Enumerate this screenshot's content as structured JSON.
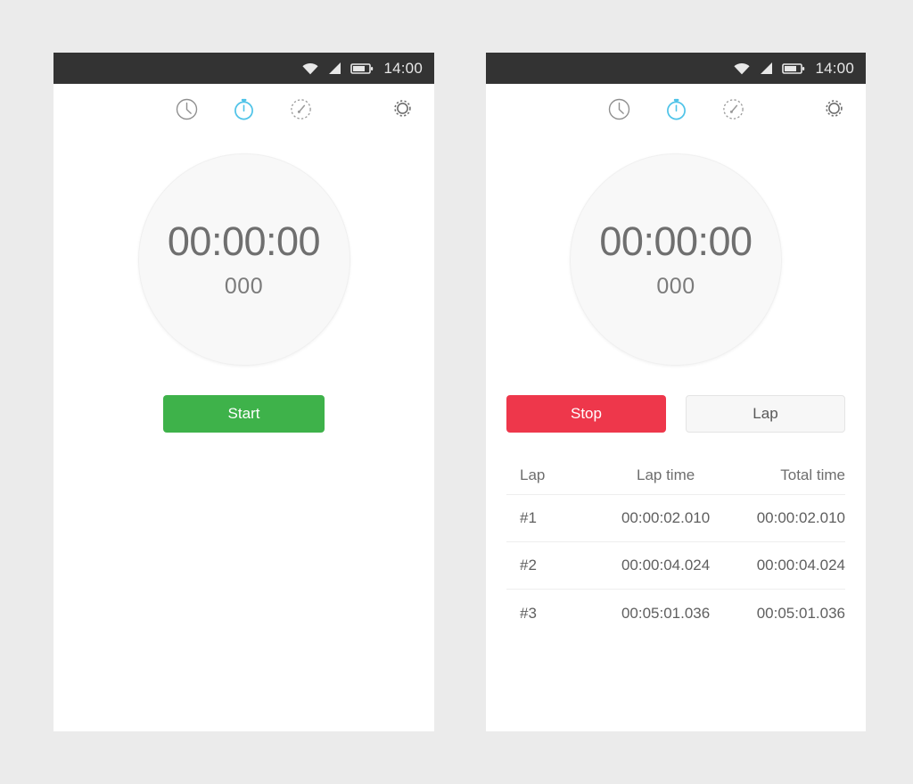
{
  "statusbar": {
    "time": "14:00",
    "icons": [
      "wifi-icon",
      "signal-icon",
      "battery-icon"
    ]
  },
  "tabs": [
    {
      "id": "clock",
      "icon": "clock-icon",
      "label": "Clock",
      "active": false
    },
    {
      "id": "stopwatch",
      "icon": "stopwatch-icon",
      "label": "Stopwatch",
      "active": true
    },
    {
      "id": "timer",
      "icon": "timer-icon",
      "label": "Timer",
      "active": false
    }
  ],
  "settings": {
    "icon": "gear-icon",
    "label": "Settings"
  },
  "colors": {
    "accent": "#4ec3e8",
    "start_green": "#3eb24a",
    "stop_red": "#ee374b",
    "statusbar_dark": "#333333",
    "page_background": "#ebebeb",
    "dial_fill": "#f8f8f8"
  },
  "left_panel": {
    "dial": {
      "time": "00:00:00",
      "milliseconds": "000"
    },
    "buttons": [
      {
        "id": "start",
        "label": "Start"
      }
    ]
  },
  "right_panel": {
    "dial": {
      "time": "00:00:00",
      "milliseconds": "000"
    },
    "buttons": [
      {
        "id": "stop",
        "label": "Stop"
      },
      {
        "id": "lap",
        "label": "Lap"
      }
    ],
    "lap_table": {
      "headers": {
        "lap": "Lap",
        "lap_time": "Lap time",
        "total_time": "Total time"
      },
      "rows": [
        {
          "lap": "#1",
          "lap_time": "00:00:02.010",
          "total_time": "00:00:02.010"
        },
        {
          "lap": "#2",
          "lap_time": "00:00:04.024",
          "total_time": "00:00:04.024"
        },
        {
          "lap": "#3",
          "lap_time": "00:05:01.036",
          "total_time": "00:05:01.036"
        }
      ]
    }
  }
}
